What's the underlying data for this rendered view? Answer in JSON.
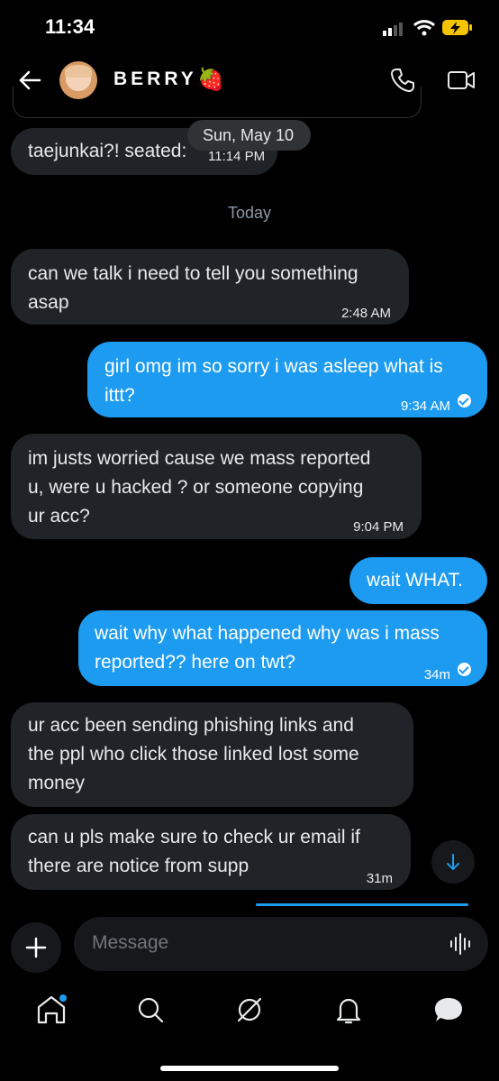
{
  "status": {
    "time": "11:34"
  },
  "header": {
    "name": "BERRY",
    "emoji": "🍓"
  },
  "date_pill": {
    "date": "Sun, May 10",
    "time": "11:14 PM"
  },
  "partial_message": {
    "text": "taejunkai?! seated:"
  },
  "divider": {
    "label": "Today"
  },
  "messages": [
    {
      "dir": "in",
      "lines": [
        "can we talk i need to tell you something",
        "asap"
      ],
      "time": "2:48 AM"
    },
    {
      "dir": "out",
      "lines": [
        "girl omg im so sorry i was asleep what is",
        "ittt?"
      ],
      "time": "9:34 AM",
      "read": true
    },
    {
      "dir": "in",
      "lines": [
        "im justs worried cause we mass reported",
        "u, were u hacked ? or someone copying",
        "ur acc?"
      ],
      "time": "9:04 PM"
    },
    {
      "dir": "out",
      "lines": [
        "wait WHAT."
      ]
    },
    {
      "dir": "out",
      "lines": [
        "wait why what happened why was i mass",
        "reported?? here on twt?"
      ],
      "time": "34m",
      "read": true
    },
    {
      "dir": "in",
      "lines": [
        "ur acc been sending phishing links  and",
        "the ppl who click those linked lost some",
        "money"
      ]
    },
    {
      "dir": "in",
      "lines": [
        "can u pls  make sure to check ur email if",
        "there are notice from supp"
      ],
      "time": "31m"
    }
  ],
  "compose": {
    "placeholder": "Message"
  },
  "icons": [
    "back-arrow-icon",
    "phone-icon",
    "video-icon",
    "plus-icon",
    "waveform-icon",
    "chevron-down-icon",
    "home-icon",
    "search-icon",
    "grok-icon",
    "bell-icon",
    "messages-icon"
  ],
  "colors": {
    "accent": "#1d9bf0",
    "incoming": "#202327",
    "background": "#000000"
  }
}
